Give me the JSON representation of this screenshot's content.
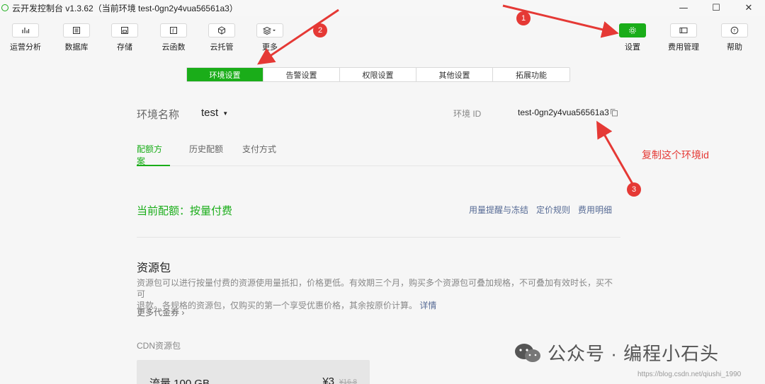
{
  "window": {
    "title": "云开发控制台 v1.3.62（当前环境 test-0gn2y4vua56561a3）",
    "buttons": [
      "—",
      "☐",
      "✕"
    ]
  },
  "toolbar": {
    "left": [
      {
        "label": "运营分析",
        "icon": "bar-chart-icon"
      },
      {
        "label": "数据库",
        "icon": "database-icon"
      },
      {
        "label": "存储",
        "icon": "storage-icon"
      },
      {
        "label": "云函数",
        "icon": "function-icon"
      },
      {
        "label": "云托管",
        "icon": "cube-icon"
      },
      {
        "label": "更多",
        "icon": "layers-icon"
      }
    ],
    "right": [
      {
        "label": "设置",
        "icon": "gear-icon"
      },
      {
        "label": "费用管理",
        "icon": "card-icon"
      },
      {
        "label": "帮助",
        "icon": "help-icon"
      }
    ]
  },
  "tabs": [
    "环境设置",
    "告警设置",
    "权限设置",
    "其他设置",
    "拓展功能"
  ],
  "env": {
    "name_label": "环境名称",
    "name_value": "test",
    "id_label": "环境 ID",
    "id_value": "test-0gn2y4vua56561a3"
  },
  "subtabs": [
    "配额方案",
    "历史配额",
    "支付方式"
  ],
  "quota": {
    "text": "当前配额：按量付费",
    "links": [
      "用量提醒与冻结",
      "定价规则",
      "费用明细"
    ]
  },
  "package": {
    "title": "资源包",
    "desc_line1": "资源包可以进行按量付费的资源使用量抵扣，价格更低。有效期三个月，购买多个资源包可叠加规格，不可叠加有效时长，买不可",
    "desc_line2": "退款。各规格的资源包，仅购买的第一个享受优惠价格，其余按原价计算。",
    "detail_link": "详情",
    "more_coupon": "更多代金券 ›",
    "cdn_label": "CDN资源包",
    "cdn_item_name": "流量 100 GB",
    "cdn_item_price": "¥3",
    "cdn_item_orig": "¥16.8"
  },
  "annotations": {
    "badges": [
      "1",
      "2",
      "3"
    ],
    "note": "复制这个环境id"
  },
  "watermark": {
    "text": "公众号 · 编程小石头",
    "csdn": "https://blog.csdn.net/qiushi_1990"
  },
  "colors": {
    "accent": "#1aad19",
    "link": "#576b95",
    "annotation": "#e53935"
  }
}
